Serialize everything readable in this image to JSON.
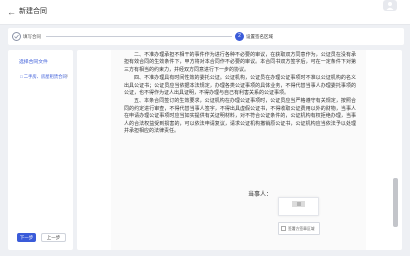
{
  "header": {
    "back_icon": "←",
    "title": "新建合同"
  },
  "steps": [
    {
      "label": "填写合同"
    },
    {
      "label": "设置签名区域",
      "number": "2"
    }
  ],
  "sidebar": {
    "heading": "选择合同文件",
    "file_name": "□ 二手房、房屋租赁合同",
    "remove_icon": "×",
    "next_button": "下一步",
    "prev_button": "上一步"
  },
  "document": {
    "paragraphs": [
      "二、不准办理承担不相干的事件作为进行各种不必要的审议，在获取双方同意作为，公证员在没有承担有效合同的生效条件下，甲方将对本合同作不必要的审议。本合同书双方签字后，可在一定条件下对第三方有相当的约束力，并经双方同意进行下一步的协议。",
      "四、不准办理具有时间性效的委托公证。公证机构，公证员在办理公证事项时不准以公证机构的名义出具公证书；公证员应当依据本法规定，办理各类公证事项的具体业务，不得代替当事人办理委托事项的公证，也不得作为证人出具证明，不得办理与自己有利害关系的公证事项。",
      "五、本条合同签订的生效要求，公证机构在办理公证事项时，公证员应当严格遵守有关规定，按照合同的约定进行审查，不得代替当事人签字，不得出具虚假公证书，不得收取公证费用以外的财物，当事人在申请办理公证事项时应当如实提供有关证明材料，对不符合公证条件的，公证机构有权拒绝办理，当事人的合法权益受到损害的，可以依法申请复议，请求公证机构撤销原公证书，公证机构应当依法予以处理并承担相应的法律责任。"
    ],
    "signer_label": "当事人："
  },
  "signature_field": {
    "label": "签署方签章区域"
  }
}
